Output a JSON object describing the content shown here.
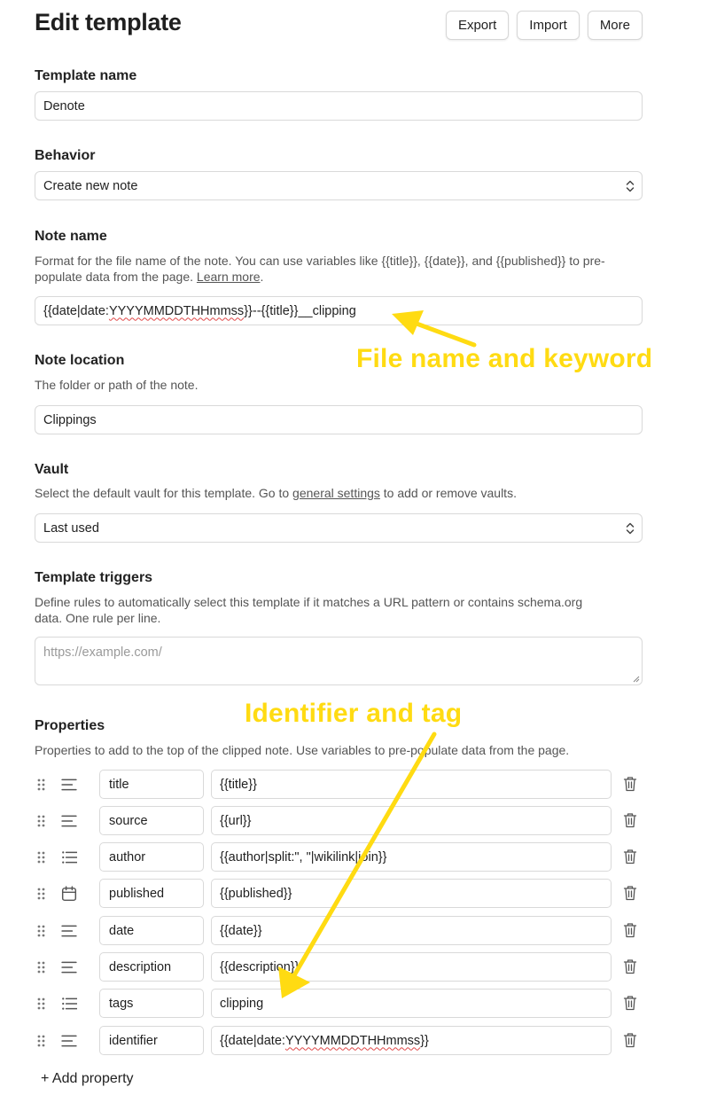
{
  "header": {
    "title": "Edit template",
    "export_label": "Export",
    "import_label": "Import",
    "more_label": "More"
  },
  "template_name": {
    "label": "Template name",
    "value": "Denote"
  },
  "behavior": {
    "label": "Behavior",
    "value": "Create new note"
  },
  "note_name": {
    "label": "Note name",
    "desc_before": "Format for the file name of the note. You can use variables like {{title}}, {{date}}, and {{published}} to pre-populate data from the page. ",
    "link": "Learn more",
    "desc_after": ".",
    "value_prefix": "{{date|date:",
    "value_fmt": "YYYYMMDDTHHmmss",
    "value_suffix": "}}--{{title}}__clipping"
  },
  "note_location": {
    "label": "Note location",
    "desc": "The folder or path of the note.",
    "value": "Clippings"
  },
  "vault": {
    "label": "Vault",
    "desc_before": "Select the default vault for this template. Go to ",
    "link": "general settings",
    "desc_after": " to add or remove vaults.",
    "value": "Last used"
  },
  "triggers": {
    "label": "Template triggers",
    "desc": "Define rules to automatically select this template if it matches a URL pattern or contains schema.org data. One rule per line.",
    "placeholder": "https://example.com/"
  },
  "properties": {
    "label": "Properties",
    "desc": "Properties to add to the top of the clipped note. Use variables to pre-populate data from the page.",
    "rows": [
      {
        "name": "title",
        "value": "{{title}}",
        "type_icon": "text-icon"
      },
      {
        "name": "source",
        "value": "{{url}}",
        "type_icon": "text-icon"
      },
      {
        "name": "author",
        "value": "{{author|split:\", \"|wikilink|join}}",
        "type_icon": "list-icon"
      },
      {
        "name": "published",
        "value": "{{published}}",
        "type_icon": "calendar-icon"
      },
      {
        "name": "date",
        "value": "{{date}}",
        "type_icon": "text-icon"
      },
      {
        "name": "description",
        "value": "{{description}}",
        "type_icon": "text-icon"
      },
      {
        "name": "tags",
        "value": "clipping",
        "type_icon": "list-icon"
      },
      {
        "name": "identifier",
        "value": "{{date|date:YYYYMMDDTHHmmss}}",
        "type_icon": "text-icon"
      }
    ],
    "add_label": "+ Add property"
  },
  "annotations": {
    "file_name": "File name and keyword",
    "identifier": "Identifier and tag"
  },
  "colors": {
    "annotation": "#ffdb12",
    "border": "#d9d9d9",
    "text": "#222222",
    "muted": "#555555"
  }
}
